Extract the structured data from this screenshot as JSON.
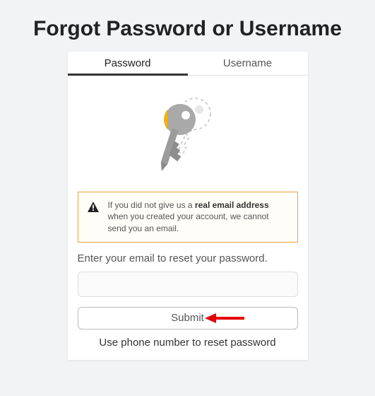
{
  "heading": "Forgot Password or Username",
  "tabs": {
    "password": "Password",
    "username": "Username"
  },
  "warning": {
    "pre": "If you did not give us a ",
    "bold": "real email address",
    "post": " when you created your account, we cannot send you an email."
  },
  "prompt": "Enter your email to reset your password.",
  "email_value": "",
  "submit_label": "Submit",
  "phone_link": "Use phone number to reset password"
}
